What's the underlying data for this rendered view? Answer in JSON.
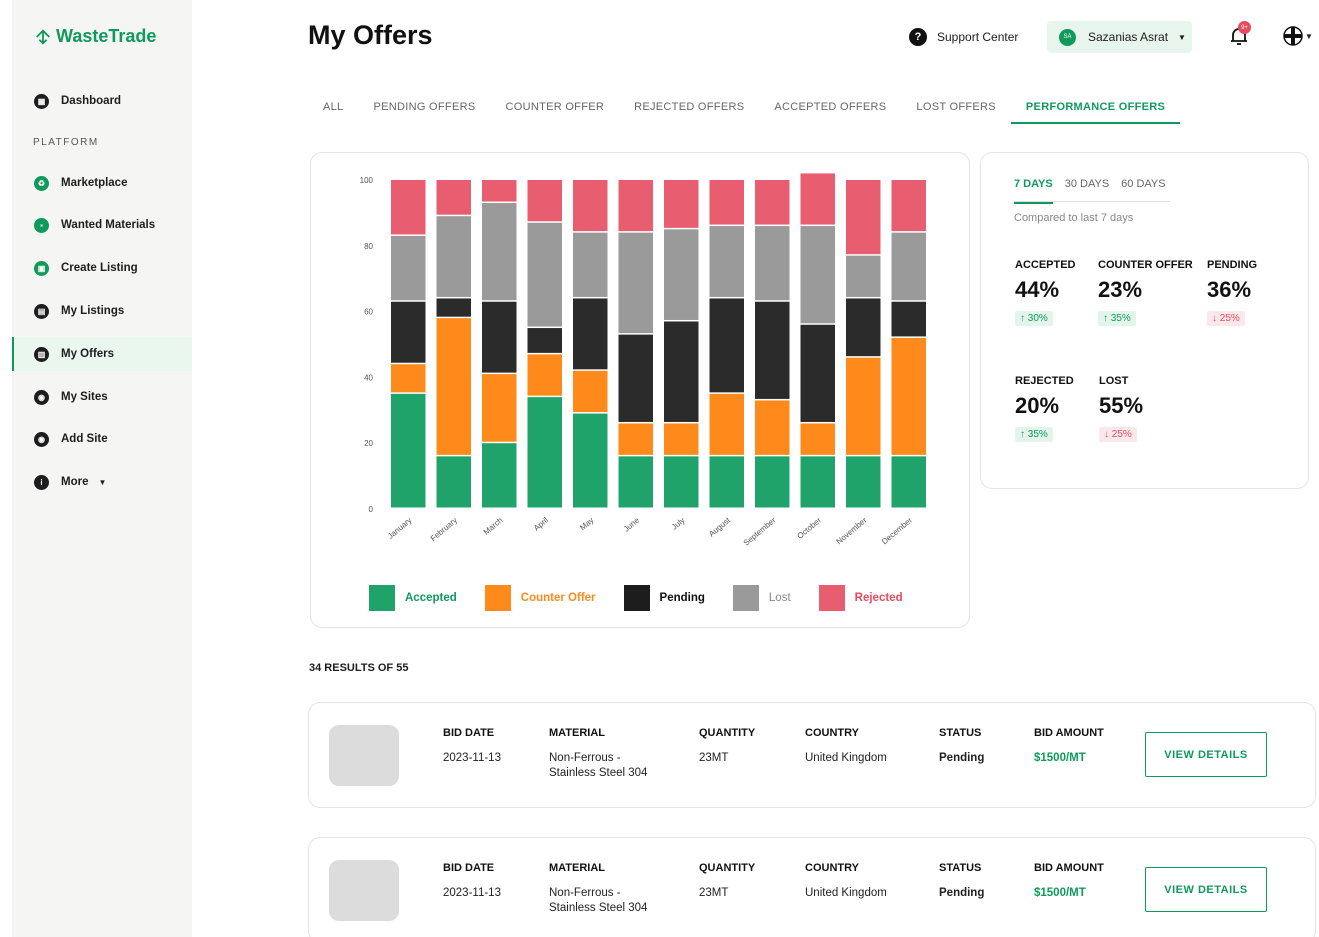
{
  "app": {
    "logo_text": "WasteTrade"
  },
  "sidebar": {
    "section_label": "PLATFORM",
    "items": [
      {
        "label": "Dashboard",
        "icon": "dashboard-icon"
      },
      {
        "label": "Marketplace",
        "icon": "recycle-icon"
      },
      {
        "label": "Wanted Materials",
        "icon": "lock-icon"
      },
      {
        "label": "Create Listing",
        "icon": "create-listing-icon"
      },
      {
        "label": "My Listings",
        "icon": "listings-icon"
      },
      {
        "label": "My Offers",
        "icon": "offers-icon"
      },
      {
        "label": "My Sites",
        "icon": "location-pin-icon"
      },
      {
        "label": "Add Site",
        "icon": "add-site-icon"
      },
      {
        "label": "More",
        "icon": "info-icon"
      }
    ]
  },
  "header": {
    "title": "My Offers",
    "support_label": "Support Center",
    "user_name": "Sazanias Asrat",
    "user_initials": "SA",
    "notification_badge": "9+"
  },
  "tabs": [
    "ALL",
    "PENDING OFFERS",
    "COUNTER OFFER",
    "REJECTED OFFERS",
    "ACCEPTED OFFERS",
    "LOST OFFERS",
    "PERFORMANCE OFFERS"
  ],
  "active_tab": 6,
  "colors": {
    "brand": "#0f9a5c",
    "accepted": "#1fa36b",
    "counter": "#ff8a1c",
    "pending": "#2b2b2b",
    "lost": "#9a9a9a",
    "rejected": "#e85e70"
  },
  "chart_data": {
    "type": "bar",
    "stacked": true,
    "categories": [
      "January",
      "February",
      "March",
      "April",
      "May",
      "June",
      "July",
      "August",
      "September",
      "October",
      "November",
      "December"
    ],
    "series": [
      {
        "name": "Accepted",
        "values": [
          35,
          16,
          20,
          34,
          29,
          16,
          16,
          16,
          16,
          16,
          16,
          16
        ]
      },
      {
        "name": "Counter Offer",
        "values": [
          9,
          42,
          21,
          13,
          13,
          10,
          10,
          19,
          17,
          10,
          30,
          36
        ]
      },
      {
        "name": "Pending",
        "values": [
          19,
          6,
          22,
          8,
          22,
          27,
          31,
          29,
          30,
          30,
          18,
          11
        ]
      },
      {
        "name": "Lost",
        "values": [
          20,
          25,
          30,
          32,
          20,
          31,
          28,
          22,
          23,
          30,
          13,
          21
        ]
      },
      {
        "name": "Rejected",
        "values": [
          17,
          11,
          7,
          13,
          16,
          16,
          15,
          14,
          14,
          16,
          23,
          16
        ]
      }
    ],
    "ylim": [
      0,
      100
    ],
    "yticks": [
      0,
      20,
      40,
      60,
      80,
      100
    ],
    "legend_position": "bottom"
  },
  "stats": {
    "periods": [
      "7 DAYS",
      "30 DAYS",
      "60 DAYS"
    ],
    "active_period": 0,
    "compared_text": "Compared to last 7 days",
    "items": [
      {
        "label": "ACCEPTED",
        "value": "44%",
        "change": "↑ 30%",
        "direction": "up"
      },
      {
        "label": "COUNTER OFFER",
        "value": "23%",
        "change": "↑ 35%",
        "direction": "up"
      },
      {
        "label": "PENDING",
        "value": "36%",
        "change": "↓ 25%",
        "direction": "down"
      },
      {
        "label": "REJECTED",
        "value": "20%",
        "change": "↑ 35%",
        "direction": "up"
      },
      {
        "label": "LOST",
        "value": "55%",
        "change": "↓ 25%",
        "direction": "down"
      }
    ]
  },
  "results_text": "34 RESULTS OF 55",
  "offer_headers": {
    "bid_date": "BID DATE",
    "material": "MATERIAL",
    "quantity": "QUANTITY",
    "country": "COUNTRY",
    "status": "STATUS",
    "bid_amount": "BID AMOUNT"
  },
  "offers": [
    {
      "bid_date": "2023-11-13",
      "material_line1": "Non-Ferrous -",
      "material_line2": "Stainless Steel 304",
      "quantity": "23MT",
      "country": "United Kingdom",
      "status": "Pending",
      "bid_amount": "$1500/MT",
      "button": "VIEW DETAILS"
    },
    {
      "bid_date": "2023-11-13",
      "material_line1": "Non-Ferrous -",
      "material_line2": "Stainless Steel 304",
      "quantity": "23MT",
      "country": "United Kingdom",
      "status": "Pending",
      "bid_amount": "$1500/MT",
      "button": "VIEW DETAILS"
    }
  ]
}
